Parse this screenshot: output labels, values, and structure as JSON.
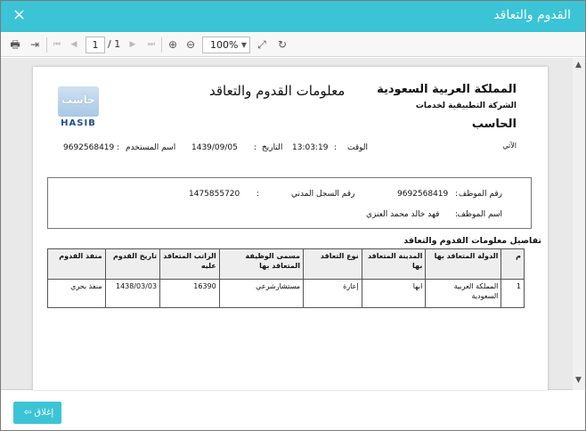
{
  "window": {
    "title": "القدوم والتعاقد",
    "close_icon": "×"
  },
  "toolbar": {
    "print_icon": "🖶",
    "export_icon": "⇥",
    "first_icon": "⏮",
    "prev_icon": "◀",
    "page_value": "1",
    "page_total": "/ 1",
    "next_icon": "▶",
    "last_icon": "⏭",
    "zoom_in_icon": "⊕",
    "zoom_out_icon": "⊖",
    "zoom_value": "100%",
    "fit_icon": "⤢",
    "refresh_icon": "↻"
  },
  "report": {
    "kingdom": "المملكة العربية السعودية",
    "company": "الشركة التطبيقية لخدمات",
    "hasib_title": "الحاسب",
    "title": "معلومات القدوم والتعاقد",
    "logo_ar": "حاسب",
    "logo_en": "HASIB",
    "amti": "الآتي",
    "user_label": "اسم المستخدم",
    "user_value": "9692568419",
    "date_label": "التاريخ",
    "date_value": "1439/09/05",
    "time_label": "الوقت",
    "time_value": "13:03:19",
    "colon": ":",
    "employee_no_label": "رقم الموظف",
    "employee_no_value": "9692568419",
    "civil_no_label": "رقم السجل المدني",
    "civil_no_value": "1475855720",
    "employee_name_label": "اسم الموظف",
    "employee_name_value": "فهد خالد محمد العنزي",
    "section_title": "تفاصيل معلومات القدوم والتعاقد",
    "table": {
      "headers": [
        "م",
        "الدولة المتعاقد بها",
        "المدينة المتعاقد بها",
        "نوع التعاقد",
        "مسمى الوظيفة المتعاقد بها",
        "الراتب المتعاقد عليه",
        "تاريخ القدوم",
        "منفذ القدوم"
      ],
      "rows": [
        [
          "1",
          "المملكة العربية السعودية",
          "ابها",
          "إعارة",
          "مستشارشرعي",
          "16390",
          "1438/03/03",
          "منفذ بحري"
        ]
      ]
    }
  },
  "footer": {
    "close_label": "إغلاق",
    "exit_icon": "⇦"
  }
}
